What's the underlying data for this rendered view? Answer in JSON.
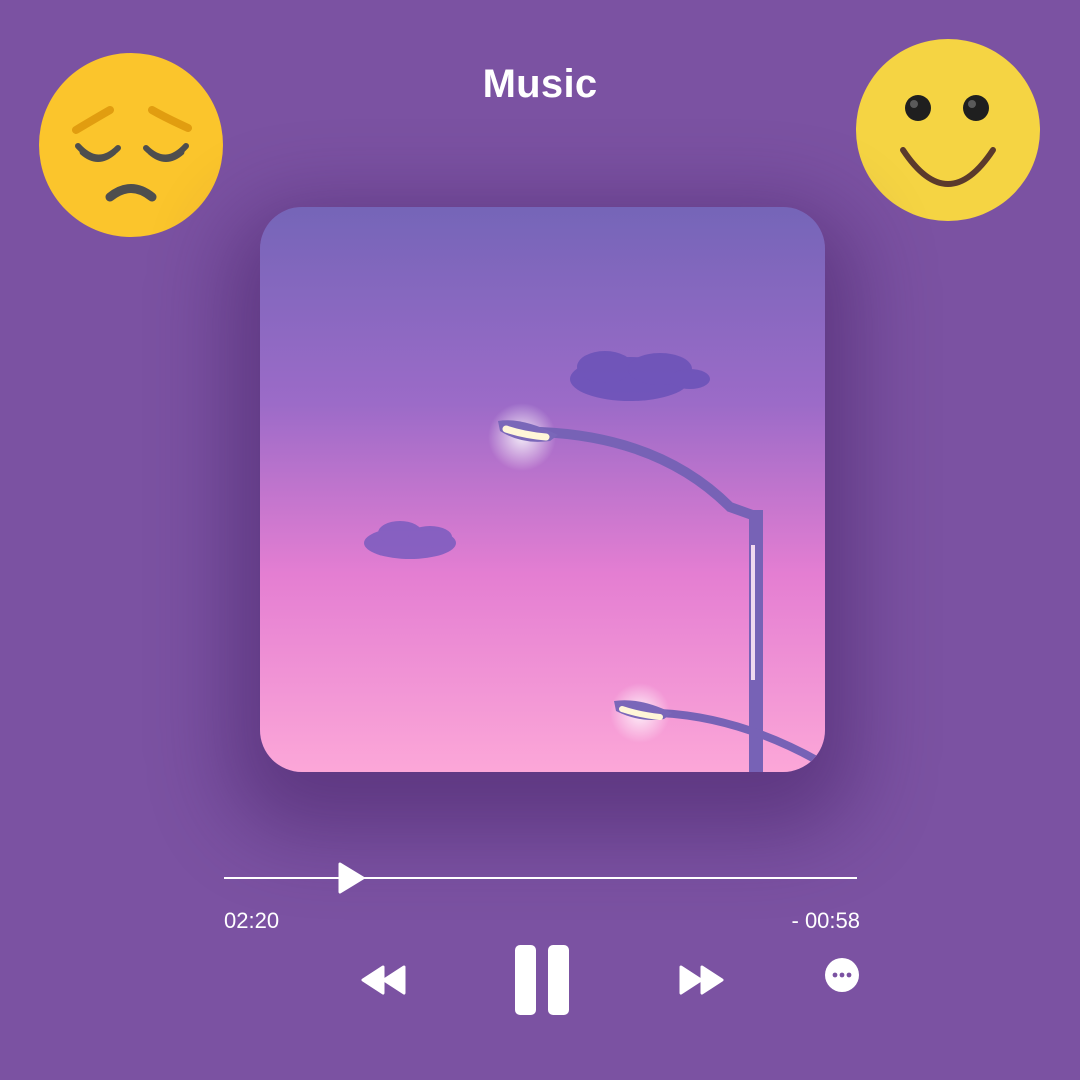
{
  "header": {
    "title": "Music"
  },
  "mood": {
    "left_icon": "pensive-face-icon",
    "right_icon": "smiling-face-icon"
  },
  "album_art": {
    "scene": "dusk-sky-streetlights"
  },
  "player": {
    "elapsed": "02:20",
    "remaining": "- 00:58",
    "progress_fraction": 0.2,
    "controls": {
      "rewind_icon": "rewind-icon",
      "pause_icon": "pause-icon",
      "forward_icon": "fast-forward-icon",
      "more_icon": "more-options-icon"
    }
  },
  "colors": {
    "background": "#7b52a2",
    "accent": "#ffffff",
    "emoji_yellow": "#f5d443",
    "emoji_sad_yellow": "#fbc52c"
  }
}
